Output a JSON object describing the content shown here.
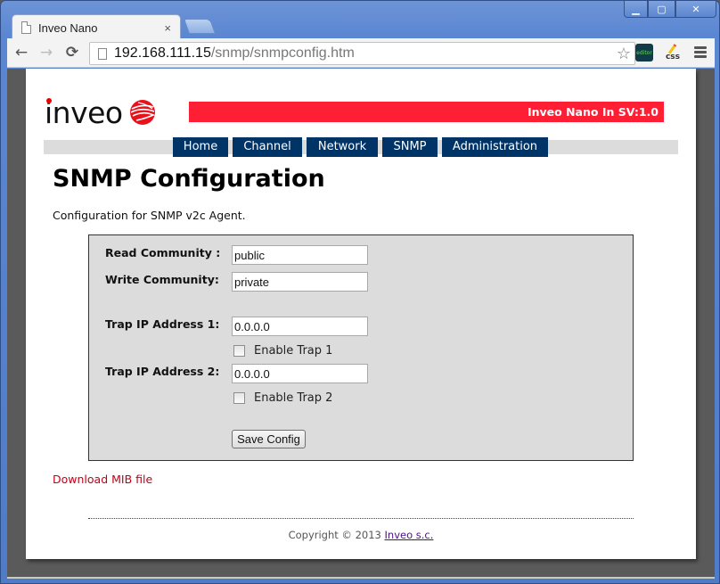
{
  "browser": {
    "tab_title": "Inveo Nano",
    "tab_close": "×",
    "url_host": "192.168.111.15",
    "url_path": "/snmp/snmpconfig.htm",
    "window_controls": {
      "minimize": "▁",
      "maximize": "▢",
      "close": "✕"
    },
    "nav": {
      "back": "←",
      "forward": "→",
      "reload": "⟳"
    },
    "star": "☆",
    "extensions": [
      {
        "name": "editor",
        "label": "editor"
      },
      {
        "name": "css",
        "label": "css"
      }
    ]
  },
  "header": {
    "logo_text": "inveo",
    "banner_text": "Inveo Nano In SV:1.0",
    "colors": {
      "banner": "#ff1f35",
      "nav": "#003366",
      "accent_link": "#c00018"
    }
  },
  "nav": {
    "items": [
      {
        "label": "Home"
      },
      {
        "label": "Channel"
      },
      {
        "label": "Network"
      },
      {
        "label": "SNMP"
      },
      {
        "label": "Administration"
      }
    ]
  },
  "main": {
    "title": "SNMP Configuration",
    "intro": "Configuration for SNMP v2c Agent.",
    "form": {
      "read_community": {
        "label": "Read Community :",
        "value": "public"
      },
      "write_community": {
        "label": "Write Community:",
        "value": "private"
      },
      "trap1": {
        "label": "Trap IP Address 1:",
        "value": "0.0.0.0",
        "enable_label": "Enable Trap 1",
        "enabled": false
      },
      "trap2": {
        "label": "Trap IP Address 2:",
        "value": "0.0.0.0",
        "enable_label": "Enable Trap 2",
        "enabled": false
      },
      "save_label": "Save Config"
    },
    "mib_link": "Download MIB file"
  },
  "footer": {
    "copyright": "Copyright © 2013 ",
    "company_link": "Inveo s.c."
  }
}
